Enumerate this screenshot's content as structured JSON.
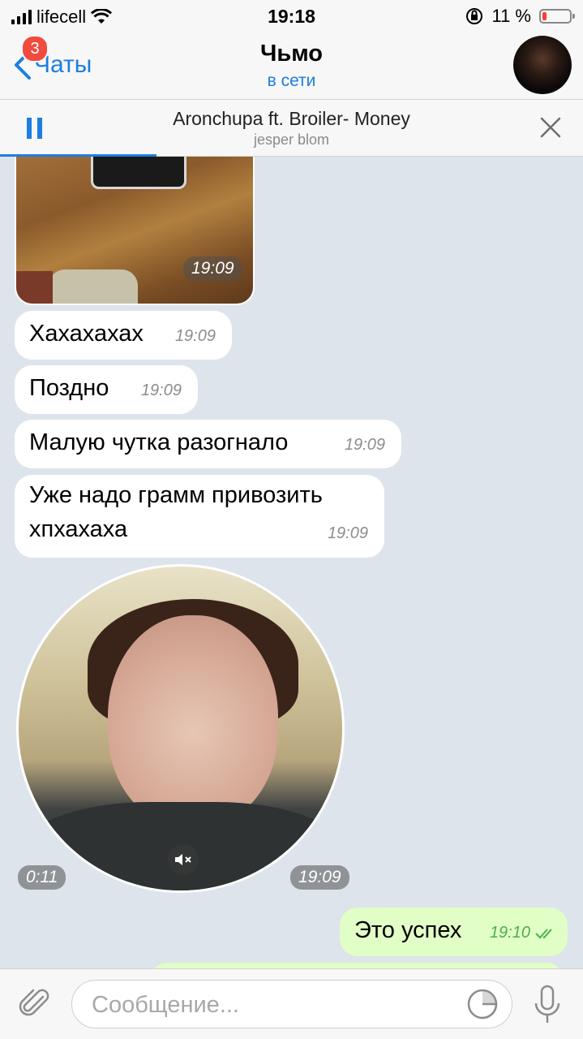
{
  "status_bar": {
    "carrier": "lifecell",
    "time": "19:18",
    "battery": "11 %"
  },
  "header": {
    "back_label": "Чаты",
    "unread_badge": "3",
    "title": "Чьмо",
    "subtitle": "в сети"
  },
  "player": {
    "track": "Aronchupa ft. Broiler- Money",
    "artist": "jesper blom"
  },
  "messages": [
    {
      "type": "photo",
      "time": "19:09"
    },
    {
      "type": "text",
      "text": "Хахахахах",
      "time": "19:09"
    },
    {
      "type": "text",
      "text": "Поздно",
      "time": "19:09"
    },
    {
      "type": "text",
      "text": "Малую чутка разогнало",
      "time": "19:09"
    },
    {
      "type": "text",
      "text": "Уже надо грамм привозить",
      "text2": "хпхахаха",
      "time": "19:09"
    },
    {
      "type": "video_note",
      "duration": "0:11",
      "time": "19:09"
    },
    {
      "type": "text_out",
      "text": "Это успех",
      "time": "19:10"
    }
  ],
  "input": {
    "placeholder": "Сообщение..."
  },
  "colors": {
    "accent": "#1c7ee0",
    "badge": "#f14b3f",
    "outgoing_bubble": "#e1fec6",
    "battery_low": "#ff3b30"
  }
}
